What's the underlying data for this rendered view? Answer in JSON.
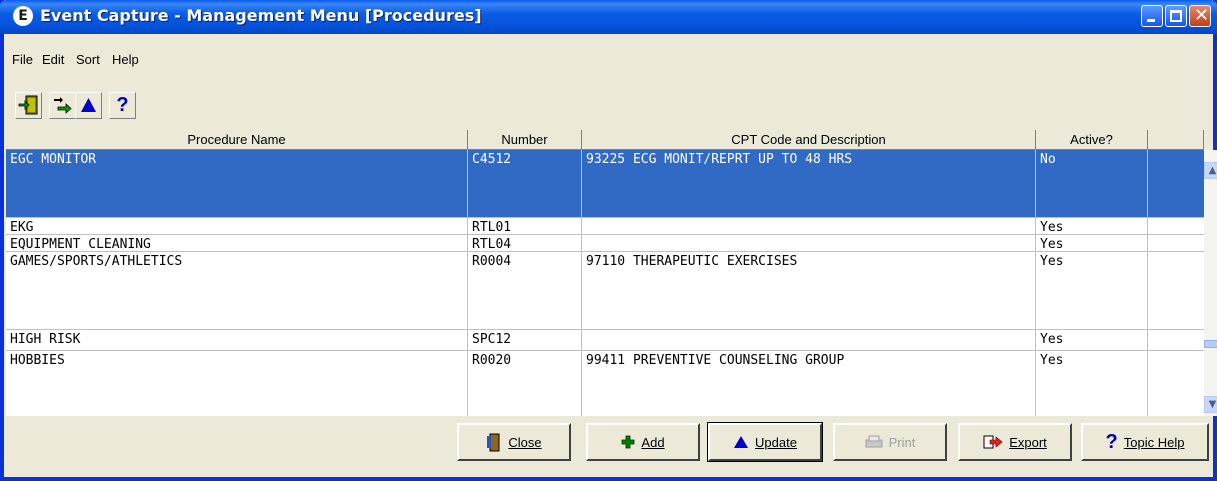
{
  "window": {
    "title": "Event Capture - Management Menu [Procedures]",
    "app_icon_glyph": "E"
  },
  "menu": [
    "File",
    "Edit",
    "Sort",
    "Help"
  ],
  "toolbar": {
    "exit_icon": "exit-door-icon",
    "move_icon": "arrows-icon",
    "update_icon": "triangle-up-icon",
    "help_glyph": "?"
  },
  "table": {
    "columns": [
      "Procedure Name",
      "Number",
      "CPT Code and Description",
      "Active?"
    ],
    "rows": [
      {
        "name": "EGC MONITOR",
        "number": "C4512",
        "cpt": "93225  ECG MONIT/REPRT UP TO 48 HRS",
        "active": "No",
        "selected": true
      },
      {
        "name": "EKG",
        "number": "RTL01",
        "cpt": "",
        "active": "Yes"
      },
      {
        "name": "EQUIPMENT CLEANING",
        "number": "RTL04",
        "cpt": "",
        "active": "Yes"
      },
      {
        "name": "GAMES/SPORTS/ATHLETICS",
        "number": "R0004",
        "cpt": "97110  THERAPEUTIC EXERCISES",
        "active": "Yes"
      },
      {
        "name": "HIGH RISK",
        "number": "SPC12",
        "cpt": "",
        "active": "Yes"
      },
      {
        "name": "HOBBIES",
        "number": "R0020",
        "cpt": "99411  PREVENTIVE COUNSELING GROUP",
        "active": "Yes"
      }
    ]
  },
  "buttons": {
    "close": "Close",
    "add": "Add",
    "update": "Update",
    "print": "Print",
    "export": "Export",
    "topic_help": "Topic Help"
  },
  "colors": {
    "selection": "#316ac5",
    "titlebar": "#0a5de6",
    "face": "#ece9d8"
  }
}
